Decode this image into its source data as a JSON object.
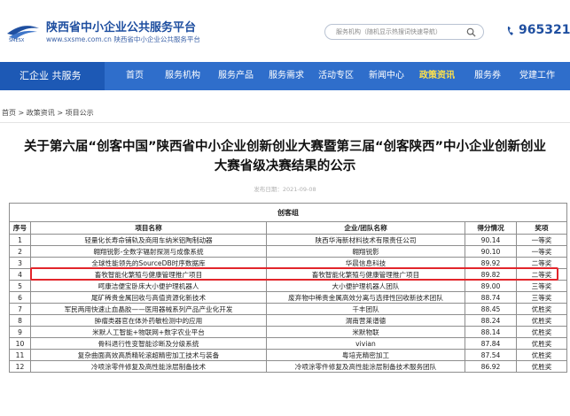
{
  "header": {
    "logo_title": "陕西省中小企业公共服务平台",
    "logo_sub": "www.sxsme.com.cn 陕西省中小企业公共服务平台",
    "search_placeholder": "服务机构（随机显示热搜词快速导航）",
    "phone": "965321",
    "colors": {
      "brand": "#1f4fa0",
      "nav": "#2f6ecb",
      "nav_active": "#ffe24a",
      "highlight": "#e2252b"
    }
  },
  "nav": {
    "brand": "汇企业 共服务",
    "items": [
      {
        "label": "首页"
      },
      {
        "label": "服务机构"
      },
      {
        "label": "服务产品"
      },
      {
        "label": "服务需求"
      },
      {
        "label": "活动专区"
      },
      {
        "label": "新闻中心"
      },
      {
        "label": "政策资讯",
        "active": true
      },
      {
        "label": "服务券"
      },
      {
        "label": "党建工作"
      }
    ]
  },
  "breadcrumb": "首页 > 政策资讯 > 项目公示",
  "article": {
    "title_line1": "关于第六届“创客中国”陕西省中小企业创新创业大赛暨第三届“创客陕西”中小企业创新创业",
    "title_line2": "大赛省级决赛结果的公示",
    "date": "发布日期：2021-09-08"
  },
  "table": {
    "group": "创客组",
    "headers": [
      "序号",
      "项目名称",
      "企业/团队名称",
      "得分情况",
      "奖项"
    ],
    "rows": [
      [
        "1",
        "轻量化长寿命铺轨及商用车纳米铝陶制动器",
        "陕西华海新材料技术有限责任公司",
        "90.14",
        "一等奖"
      ],
      [
        "2",
        "翱翔锐影-全数字辐射探测与成像系统",
        "翱翔锐影",
        "90.10",
        "一等奖"
      ],
      [
        "3",
        "全球性能领先的SourceDB时序数据库",
        "华晨信息科技",
        "89.92",
        "二等奖"
      ],
      [
        "4",
        "畜牧智能化繁殖与健康管理推广项目",
        "畜牧智能化繁殖与健康管理推广项目",
        "89.82",
        "二等奖"
      ],
      [
        "5",
        "呵康洁便宝卧床大小便护理机器人",
        "大小便护理机器人团队",
        "89.00",
        "三等奖"
      ],
      [
        "6",
        "尾矿稀贵金属回收与高值资源化新技术",
        "废弃物中稀贵金属高效分离与选择性回收新技术团队",
        "88.74",
        "三等奖"
      ],
      [
        "7",
        "军民两用快速止血晶胶——医用器械系列产品产业化开发",
        "千丰团队",
        "88.45",
        "优胜奖"
      ],
      [
        "8",
        "肿瘤类器官在体外药敏检测中的应用",
        "渭南营莱谱德",
        "88.24",
        "优胜奖"
      ],
      [
        "9",
        "米默人工智能+物联网+数字农业平台",
        "米默物联",
        "88.14",
        "优胜奖"
      ],
      [
        "10",
        "骨科退行性变智能诊断及分级系统",
        "vivian",
        "87.84",
        "优胜奖"
      ],
      [
        "11",
        "复杂曲面高效高质精轮滚超精密加工技术与装备",
        "粤培克精密加工",
        "87.54",
        "优胜奖"
      ],
      [
        "12",
        "冷喷涂零件修复及高性能涂层制备技术",
        "冷喷涂零件修复及高性能涂层制备技术服务团队",
        "86.92",
        "优胜奖"
      ]
    ]
  }
}
